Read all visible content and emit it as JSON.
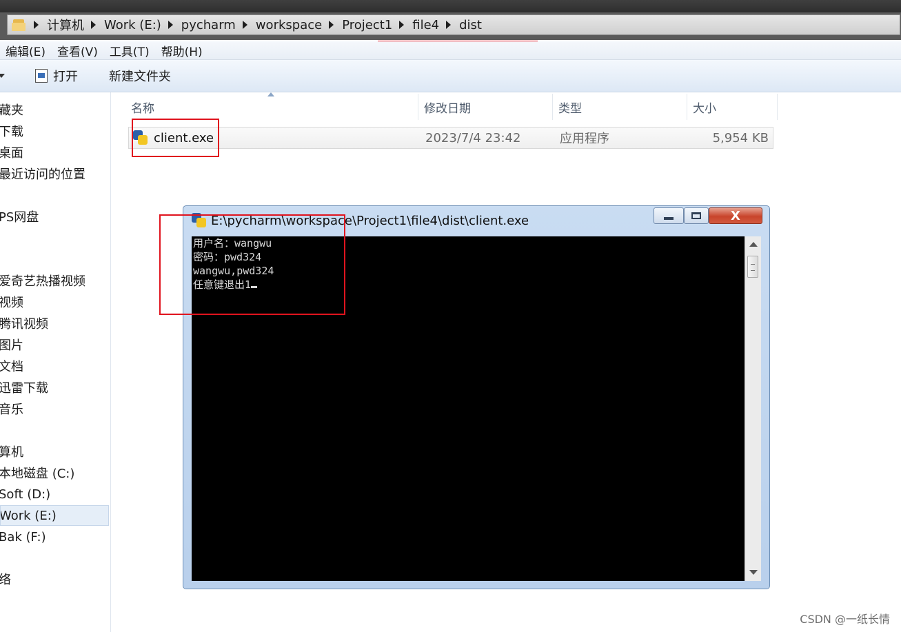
{
  "address_bar": {
    "crumbs": [
      "计算机",
      "Work (E:)",
      "pycharm",
      "workspace",
      "Project1",
      "file4",
      "dist"
    ]
  },
  "menu": [
    "编辑(E)",
    "查看(V)",
    "工具(T)",
    "帮助(H)"
  ],
  "toolbar": {
    "open_label": "打开",
    "new_folder_label": "新建文件夹"
  },
  "nav": {
    "items": [
      "藏夹",
      "下载",
      "桌面",
      "最近访问的位置",
      "PS网盘",
      "爱奇艺热播视频",
      "视频",
      "腾讯视频",
      "图片",
      "文档",
      "迅雷下载",
      "音乐",
      "算机",
      "本地磁盘 (C:)",
      "Soft (D:)",
      "Work (E:)",
      "Bak (F:)",
      "络"
    ],
    "selected": "Work (E:)"
  },
  "columns": {
    "name": "名称",
    "modified": "修改日期",
    "type": "类型",
    "size": "大小"
  },
  "file": {
    "name": "client.exe",
    "modified": "2023/7/4 23:42",
    "type": "应用程序",
    "size": "5,954 KB"
  },
  "console": {
    "title": "E:\\pycharm\\workspace\\Project1\\file4\\dist\\client.exe",
    "lines": [
      "用户名：wangwu",
      "密码：pwd324",
      "wangwu,pwd324",
      "任意键退出1"
    ],
    "close_glyph": "X"
  },
  "watermark": "CSDN @一纸长情",
  "colors": {
    "highlight_red": "#e0141e",
    "console_bg": "#000000",
    "title_bar": "#c9dcf2"
  }
}
